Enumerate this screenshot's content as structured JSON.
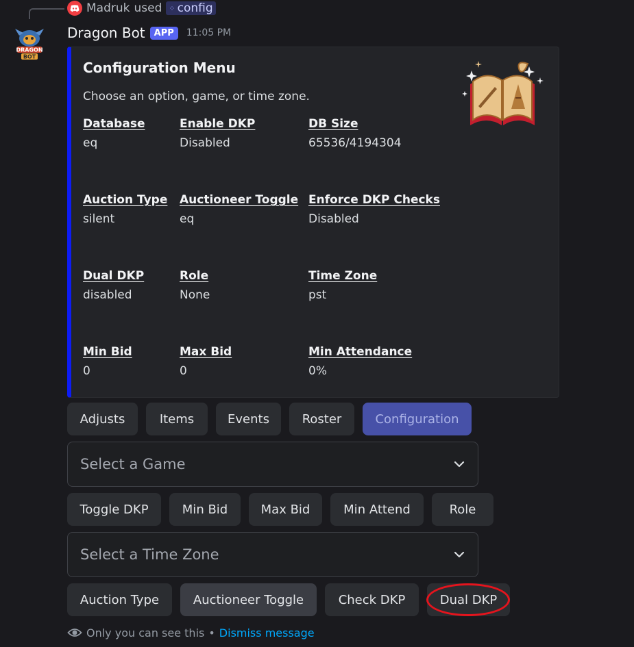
{
  "reply": {
    "user": "Madruk",
    "used_text": "used",
    "command": "config"
  },
  "message": {
    "bot_name": "Dragon Bot",
    "app_tag": "APP",
    "timestamp": "11:05 PM"
  },
  "embed": {
    "accent_color": "#0d1cf5",
    "title": "Configuration Menu",
    "description": "Choose an option, game, or time zone.",
    "fields": [
      {
        "name": "Database",
        "value": "eq"
      },
      {
        "name": "Enable DKP",
        "value": "Disabled"
      },
      {
        "name": "DB Size",
        "value": "65536/4194304"
      },
      {
        "name": "Auction Type",
        "value": "silent"
      },
      {
        "name": "Auctioneer Toggle",
        "value": "eq"
      },
      {
        "name": "Enforce DKP Checks",
        "value": "Disabled"
      },
      {
        "name": "Dual DKP",
        "value": "disabled"
      },
      {
        "name": "Role",
        "value": "None"
      },
      {
        "name": "Time Zone",
        "value": "pst"
      },
      {
        "name": "Min Bid",
        "value": "0"
      },
      {
        "name": "Max Bid",
        "value": "0"
      },
      {
        "name": "Min Attendance",
        "value": "0%"
      }
    ]
  },
  "nav_buttons": [
    "Adjusts",
    "Items",
    "Events",
    "Roster",
    "Configuration"
  ],
  "game_select": {
    "placeholder": "Select a Game"
  },
  "option_buttons": [
    "Toggle DKP",
    "Min Bid",
    "Max Bid",
    "Min Attend",
    "Role"
  ],
  "timezone_select": {
    "placeholder": "Select a Time Zone"
  },
  "toggle_buttons": [
    "Auction Type",
    "Auctioneer Toggle",
    "Check DKP",
    "Dual DKP"
  ],
  "footer": {
    "notice": "Only you can see this",
    "separator": "•",
    "dismiss": "Dismiss message"
  },
  "icons": {
    "reply_app": "discord-icon",
    "command": "slash-command-icon",
    "thumbnail": "spellbook-icon",
    "select_chevron": "chevron-down-icon",
    "footer": "eye-icon"
  },
  "colors": {
    "highlight_ring": "#e5141d",
    "active_button": "#4751a8",
    "link": "#00a8fc"
  }
}
